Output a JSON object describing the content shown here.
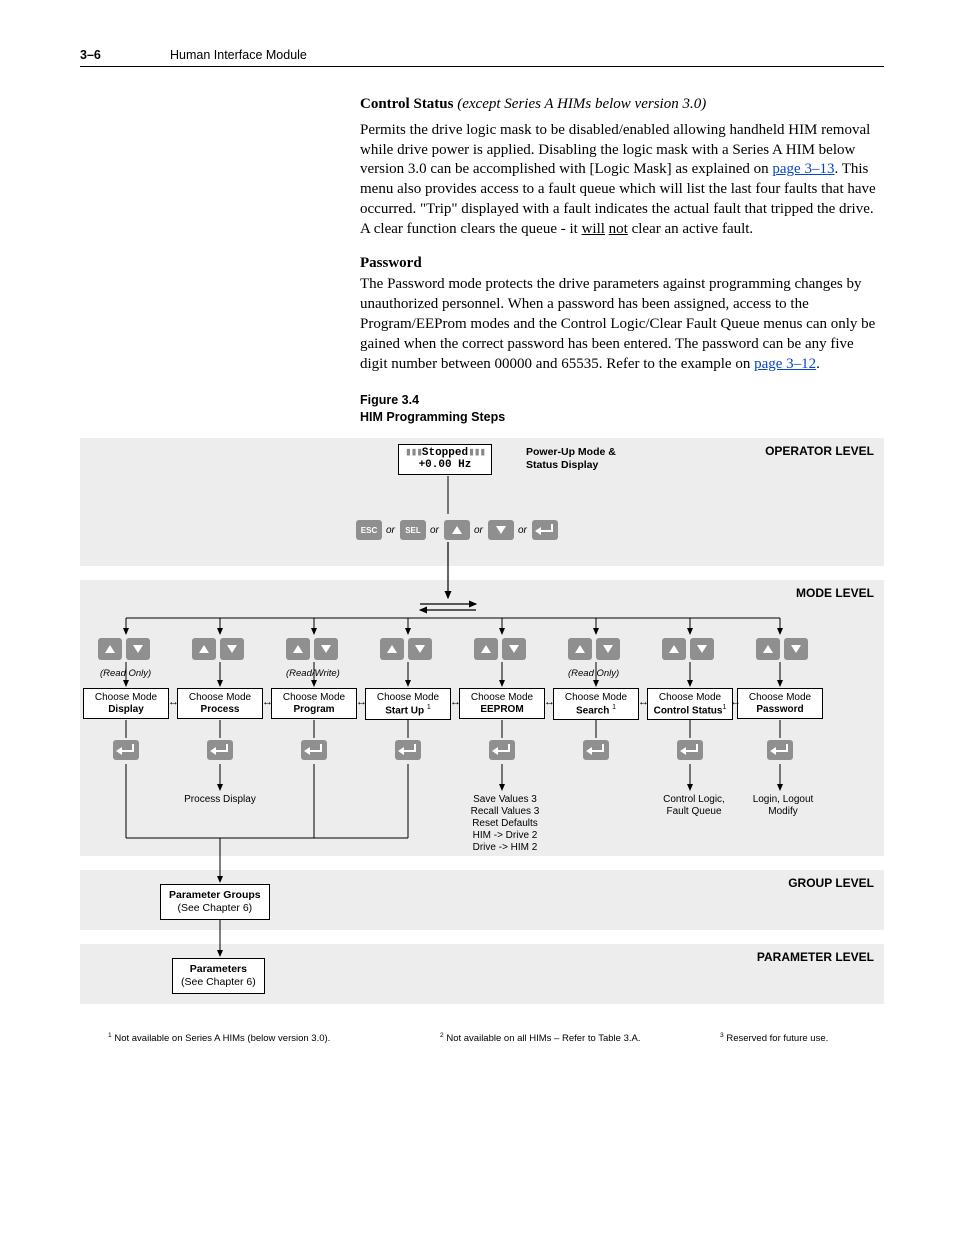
{
  "header": {
    "page": "3–6",
    "section": "Human Interface Module"
  },
  "sec1": {
    "title": "Control Status",
    "qualifier": "(except Series A HIMs below version 3.0)",
    "text_a": "Permits the drive logic mask to be disabled/enabled allowing handheld HIM removal while drive power is applied. Disabling the logic mask with a Series A HIM below version 3.0 can be accomplished with [Logic Mask] as explained on ",
    "link1": "page 3–13",
    "text_b": ". This menu also provides access to a fault queue which will list the last four faults that have occurred. \"Trip\" displayed with a fault indicates the actual fault that tripped the drive. A clear function clears the queue - it ",
    "u1": "will",
    "u2": "not",
    "text_c": " clear an active fault."
  },
  "sec2": {
    "title": "Password",
    "text_a": "The Password mode protects the drive parameters against programming changes by unauthorized personnel. When a password has been assigned, access to the Program/EEProm modes and the Control Logic/Clear Fault Queue menus can only be gained when the correct password has been entered. The password can be any five digit number between 00000 and 65535. Refer to the example on ",
    "link": "page 3–12",
    "text_b": "."
  },
  "fig": {
    "num": "Figure 3.4",
    "title": "HIM Programming Steps"
  },
  "chart_data": {
    "type": "diagram",
    "levels": [
      "OPERATOR LEVEL",
      "MODE LEVEL",
      "GROUP LEVEL",
      "PARAMETER LEVEL"
    ],
    "lcd_lines": [
      "Stopped",
      "+0.00 Hz"
    ],
    "lcd_label": "Power-Up Mode & Status Display",
    "keys_row": [
      "ESC",
      "SEL",
      "▲",
      "▼",
      "↵"
    ],
    "or": "or",
    "read_only": "(Read Only)",
    "read_write": "(Read/Write)",
    "modes": [
      {
        "top": "Choose Mode",
        "name": "Display",
        "note": "(Read Only)",
        "detail": ""
      },
      {
        "top": "Choose Mode",
        "name": "Process",
        "note": "",
        "detail": "Process Display"
      },
      {
        "top": "Choose Mode",
        "name": "Program",
        "note": "(Read/Write)",
        "detail": ""
      },
      {
        "top": "Choose Mode",
        "name": "Start Up",
        "sup": "1",
        "note": "",
        "detail": ""
      },
      {
        "top": "Choose Mode",
        "name": "EEPROM",
        "note": "",
        "detail_lines": [
          "Save Values 3",
          "Recall Values 3",
          "Reset Defaults",
          "HIM -> Drive 2",
          "Drive -> HIM 2"
        ]
      },
      {
        "top": "Choose Mode",
        "name": "Search",
        "sup": "1",
        "note": "(Read Only)",
        "detail": ""
      },
      {
        "top": "Choose Mode",
        "name": "Control Status",
        "sup": "1",
        "note": "",
        "detail_lines": [
          "Control Logic,",
          "Fault Queue"
        ]
      },
      {
        "top": "Choose Mode",
        "name": "Password",
        "note": "",
        "detail_lines": [
          "Login, Logout",
          "Modify"
        ]
      }
    ],
    "group_box": {
      "title": "Parameter Groups",
      "sub": "(See Chapter 6)"
    },
    "param_box": {
      "title": "Parameters",
      "sub": "(See Chapter 6)"
    },
    "footnotes": [
      {
        "n": "1",
        "text": "Not available on Series A HIMs (below version 3.0)."
      },
      {
        "n": "2",
        "text": "Not available on all HIMs – Refer to Table 3.A."
      },
      {
        "n": "3",
        "text": "Reserved for future use."
      }
    ]
  }
}
